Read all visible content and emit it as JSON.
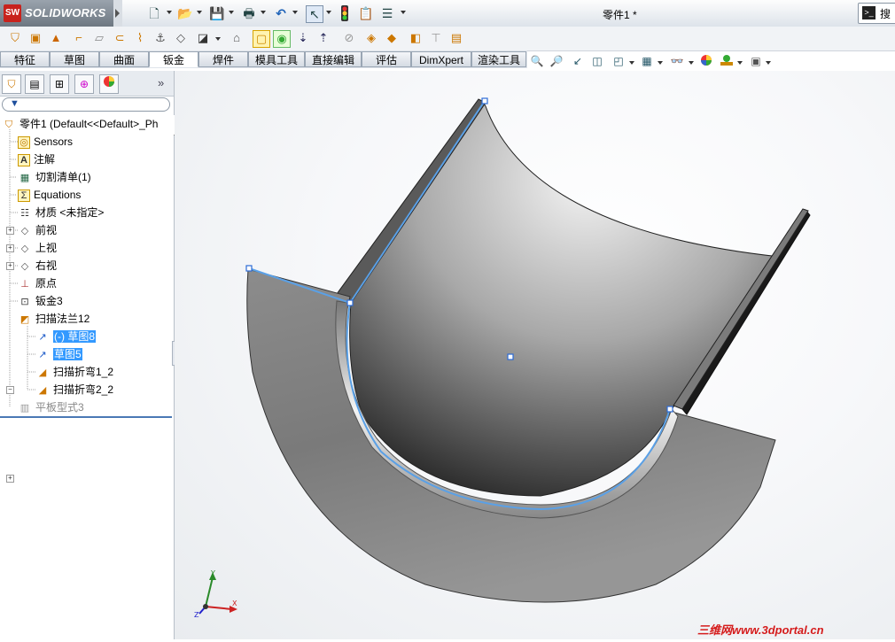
{
  "app": {
    "brand": "SOLIDWORKS",
    "document_title": "零件1 *",
    "search_label": "搜"
  },
  "tabs": [
    {
      "label": "特征",
      "active": false
    },
    {
      "label": "草图",
      "active": false
    },
    {
      "label": "曲面",
      "active": false
    },
    {
      "label": "钣金",
      "active": true
    },
    {
      "label": "焊件",
      "active": false
    },
    {
      "label": "模具工具",
      "active": false
    },
    {
      "label": "直接编辑",
      "active": false
    },
    {
      "label": "评估",
      "active": false
    },
    {
      "label": "DimXpert",
      "active": false
    },
    {
      "label": "渲染工具",
      "active": false
    }
  ],
  "panel": {
    "expand_label": "»"
  },
  "tree": {
    "root": "零件1  (Default<<Default>_Ph",
    "items": [
      {
        "label": "Sensors",
        "icon": "sensor-icon"
      },
      {
        "label": "注解",
        "icon": "annotation-icon"
      },
      {
        "label": "切割清单(1)",
        "icon": "cutlist-icon"
      },
      {
        "label": "Equations",
        "icon": "equations-icon"
      },
      {
        "label": "材质 <未指定>",
        "icon": "material-icon"
      },
      {
        "label": "前视",
        "icon": "plane-icon"
      },
      {
        "label": "上视",
        "icon": "plane-icon"
      },
      {
        "label": "右视",
        "icon": "plane-icon"
      },
      {
        "label": "原点",
        "icon": "origin-icon"
      },
      {
        "label": "钣金3",
        "icon": "sheetmetal-icon"
      },
      {
        "label": "扫描法兰12",
        "icon": "swept-flange-icon"
      },
      {
        "label": "(-) 草图8",
        "icon": "sketch-icon"
      },
      {
        "label": "草图5",
        "icon": "sketch-icon"
      },
      {
        "label": "扫描折弯1_2",
        "icon": "bend-icon"
      },
      {
        "label": "扫描折弯2_2",
        "icon": "bend-icon"
      },
      {
        "label": "平板型式3",
        "icon": "flat-pattern-icon"
      }
    ]
  },
  "watermark": "三维网www.3dportal.cn",
  "colors": {
    "accent": "#3399ff",
    "brand_red": "#c8221c",
    "sketch_blue": "#5aa0e6"
  }
}
